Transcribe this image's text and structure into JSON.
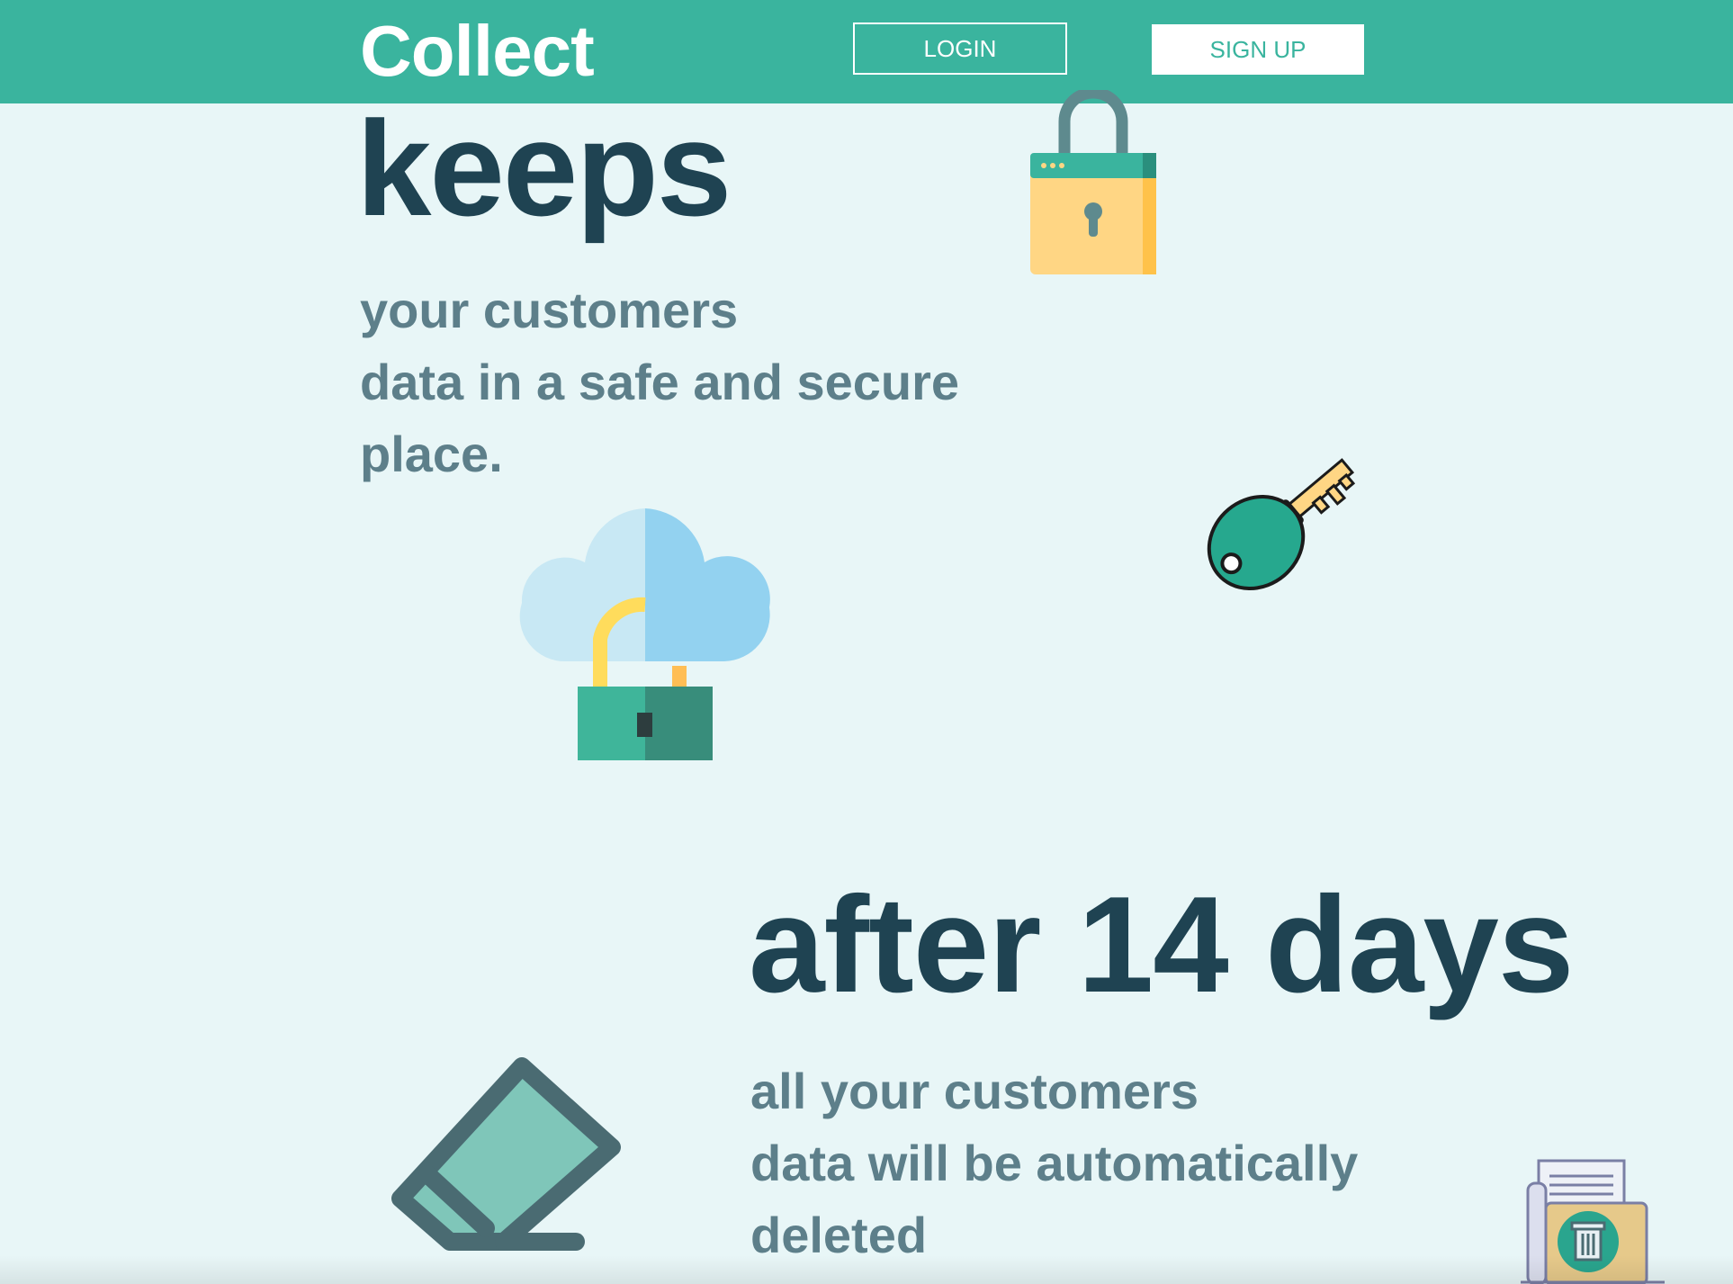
{
  "header": {
    "brand": "Collect",
    "login_label": "LOGIN",
    "signup_label": "SIGN UP"
  },
  "section_keeps": {
    "heading": "keeps",
    "lines": [
      "your customers",
      "data in a safe and secure",
      "place."
    ]
  },
  "section_delete": {
    "heading": "after 14 days",
    "lines": [
      "all your customers",
      "data will be automatically",
      "deleted"
    ]
  },
  "icons": [
    "padlock-icon",
    "key-icon",
    "cloud-lock-icon",
    "eraser-icon",
    "trash-doc-icon"
  ],
  "colors": {
    "accent": "#3ab49e",
    "background": "#e8f6f7",
    "heading": "#1f4352",
    "body_text": "#5d7f8a"
  }
}
